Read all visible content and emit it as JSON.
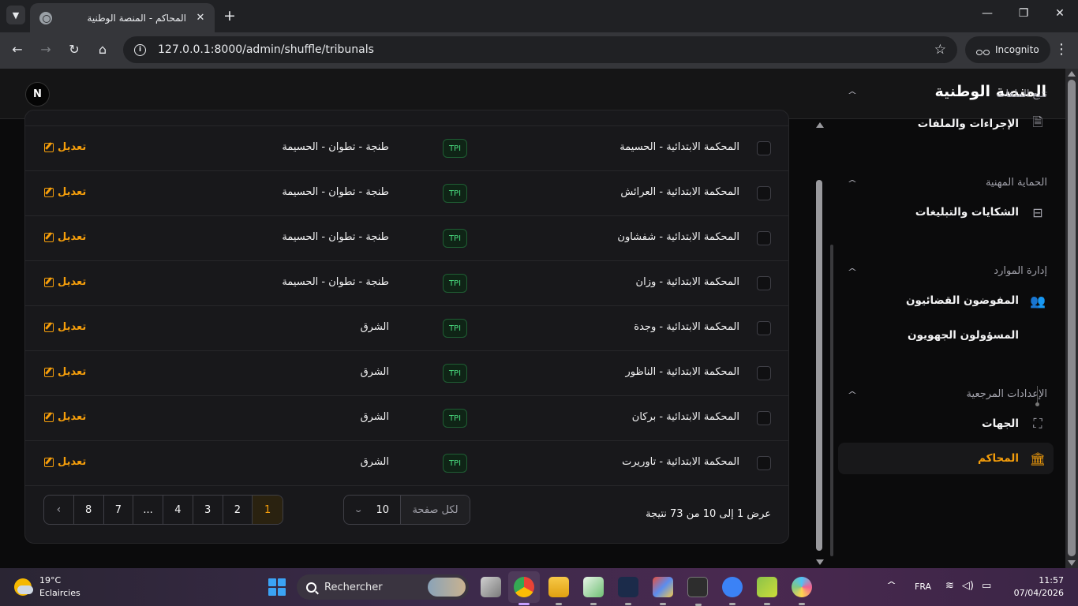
{
  "browser": {
    "tab_title": "المحاكم - المنصة الوطنية",
    "url": "127.0.0.1:8000/admin/shuffle/tribunals",
    "incognito_label": "Incognito"
  },
  "header": {
    "avatar_initial": "N",
    "brand": "المنصة الوطنية"
  },
  "sidebar": {
    "groups": [
      {
        "title": "تتبع الملفات",
        "items": [
          {
            "label": "الإجراءات والملفات",
            "icon": "file-icon"
          }
        ]
      },
      {
        "title": "الحماية المهنية",
        "items": [
          {
            "label": "الشكايات والتبليغات",
            "icon": "inbox-icon"
          }
        ]
      },
      {
        "title": "إدارة الموارد",
        "items": [
          {
            "label": "المفوضون القضائيون",
            "icon": "users-icon"
          },
          {
            "label": "المسؤولون الجهويون",
            "icon": ""
          }
        ]
      },
      {
        "title": "الإعدادات المرجعية",
        "items": [
          {
            "label": "الجهات",
            "icon": "map-icon"
          },
          {
            "label": "المحاكم",
            "icon": "courthouse-icon",
            "active": true
          }
        ]
      }
    ]
  },
  "table": {
    "edit_label": "تعديل",
    "rows": [
      {
        "name": "المحكمة الابتدائية - الحسيمة",
        "type": "TPI",
        "region": "طنجة - تطوان - الحسيمة"
      },
      {
        "name": "المحكمة الابتدائية - العرائش",
        "type": "TPI",
        "region": "طنجة - تطوان - الحسيمة"
      },
      {
        "name": "المحكمة الابتدائية - شفشاون",
        "type": "TPI",
        "region": "طنجة - تطوان - الحسيمة"
      },
      {
        "name": "المحكمة الابتدائية - وزان",
        "type": "TPI",
        "region": "طنجة - تطوان - الحسيمة"
      },
      {
        "name": "المحكمة الابتدائية - وجدة",
        "type": "TPI",
        "region": "الشرق"
      },
      {
        "name": "المحكمة الابتدائية - الناظور",
        "type": "TPI",
        "region": "الشرق"
      },
      {
        "name": "المحكمة الابتدائية - بركان",
        "type": "TPI",
        "region": "الشرق"
      },
      {
        "name": "المحكمة الابتدائية - تاوريرت",
        "type": "TPI",
        "region": "الشرق"
      }
    ],
    "footer": {
      "result_text": "عرض 1 إلى 10 من 73 نتيجة",
      "per_page_label": "لكل صفحة",
      "per_page_value": "10",
      "pages": [
        "1",
        "2",
        "3",
        "4",
        "...",
        "7",
        "8"
      ],
      "active_page": "1"
    }
  },
  "taskbar": {
    "temperature": "19°C",
    "weather": "Eclaircies",
    "search_placeholder": "Rechercher",
    "language": "FRA",
    "time": "11:57",
    "date": "07/04/2026"
  },
  "colors": {
    "accent": "#f59e0b",
    "badge_green": "#4ade80",
    "background": "#0b0b0c",
    "card": "#18181b"
  }
}
